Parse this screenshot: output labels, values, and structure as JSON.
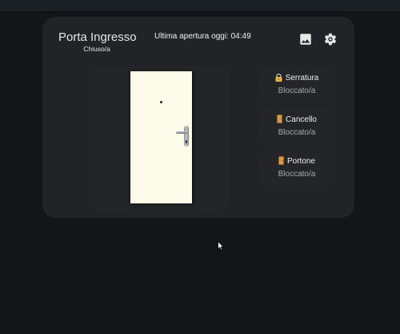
{
  "window": {
    "title": "Porta Ingresso",
    "state": "Chiuso/a",
    "last_open": "Ultima apertura oggi: 04:49"
  },
  "toolbar": {
    "image_icon": "image-icon",
    "settings_icon": "gear-icon"
  },
  "status_items": [
    {
      "label": "Serratura",
      "value": "Bloccato/a",
      "icon": "padlock-icon"
    },
    {
      "label": "Cancello",
      "value": "Bloccato/a",
      "icon": "door-icon"
    },
    {
      "label": "Portone",
      "value": "Bloccato/a",
      "icon": "door-icon"
    }
  ],
  "colors": {
    "background": "#141518",
    "card": "#222327",
    "door": "#fdfbe9",
    "lock_icon": "#e9b04a",
    "door_icon": "#d49a4e"
  }
}
